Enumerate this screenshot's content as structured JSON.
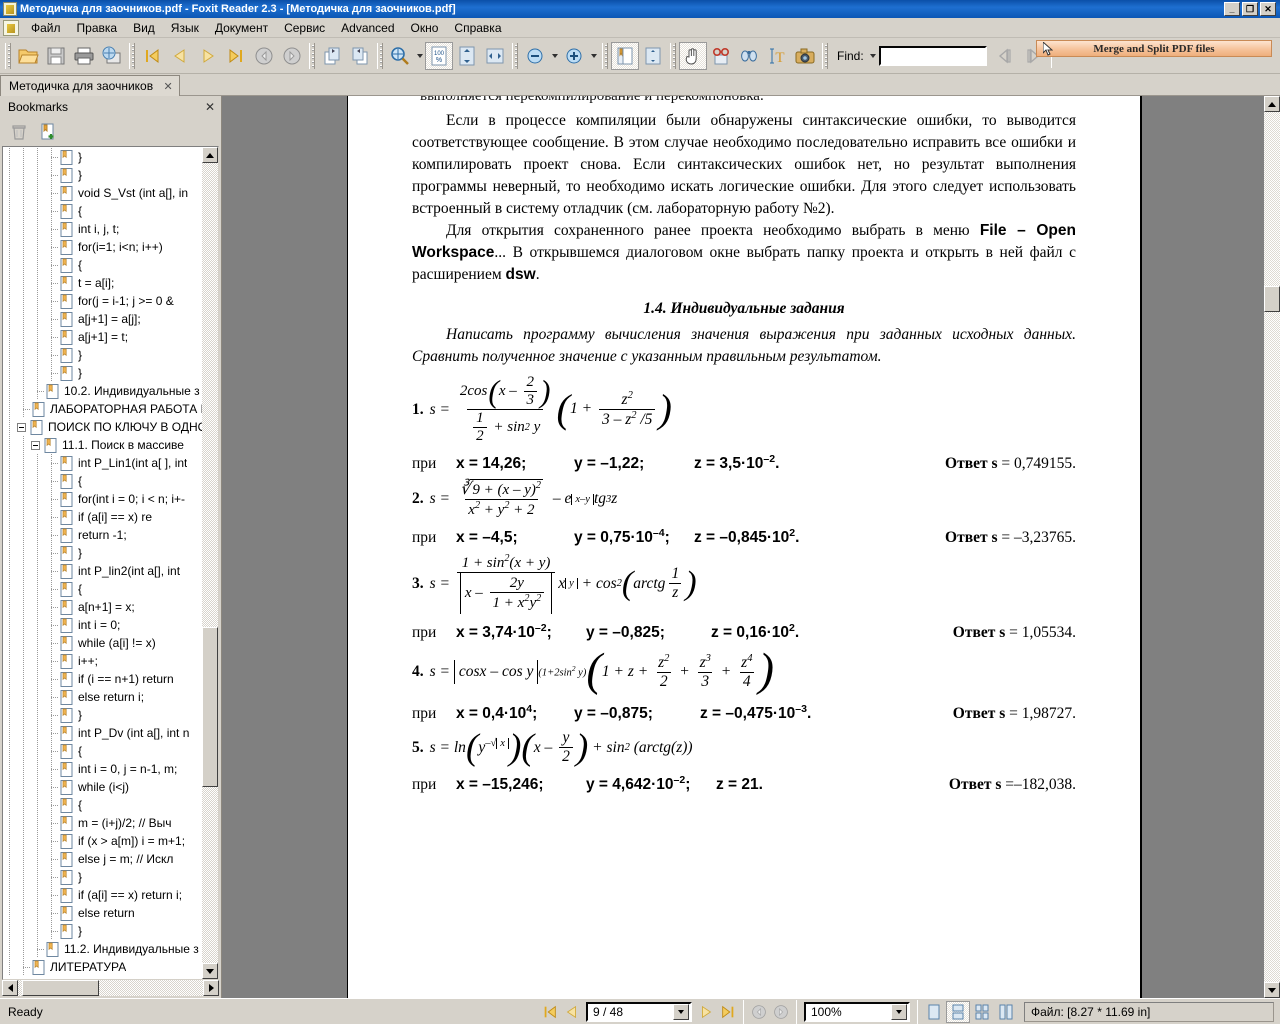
{
  "window": {
    "title": "Методичка для заочников.pdf - Foxit Reader 2.3 - [Методичка для заочников.pdf]",
    "minimize": "_",
    "maximize": "❐",
    "close": "✕"
  },
  "menu": {
    "items": [
      {
        "label": "Файл"
      },
      {
        "label": "Правка"
      },
      {
        "label": "Вид"
      },
      {
        "label": "Язык"
      },
      {
        "label": "Документ"
      },
      {
        "label": "Сервис"
      },
      {
        "label": "Advanced"
      },
      {
        "label": "Окно"
      },
      {
        "label": "Справка"
      }
    ]
  },
  "toolbar": {
    "find_label": "Find:",
    "find_value": "",
    "find_placeholder": "",
    "promo_label": "Merge and Split PDF files",
    "buttons": [
      {
        "name": "open-icon"
      },
      {
        "name": "save-icon"
      },
      {
        "name": "print-icon"
      },
      {
        "name": "email-icon"
      },
      {
        "name": "first-page-icon"
      },
      {
        "name": "previous-page-icon"
      },
      {
        "name": "next-page-icon"
      },
      {
        "name": "last-page-icon"
      },
      {
        "name": "go-back-icon"
      },
      {
        "name": "go-forward-icon"
      },
      {
        "name": "rotate-clockwise-icon"
      },
      {
        "name": "rotate-counterclockwise-icon"
      },
      {
        "name": "zoom-tool-icon"
      },
      {
        "name": "actual-size-icon"
      },
      {
        "name": "fit-page-icon"
      },
      {
        "name": "fit-width-icon"
      },
      {
        "name": "zoom-out-icon"
      },
      {
        "name": "zoom-in-icon"
      },
      {
        "name": "bookmarks-pane-icon"
      },
      {
        "name": "page-thumbnails-icon"
      },
      {
        "name": "hand-tool-icon"
      },
      {
        "name": "read-mode-icon"
      },
      {
        "name": "find-icon"
      },
      {
        "name": "text-select-icon"
      },
      {
        "name": "snapshot-icon"
      },
      {
        "name": "find-previous-icon"
      },
      {
        "name": "find-next-icon"
      }
    ]
  },
  "tab": {
    "label": "Методичка для заочников",
    "close": "✕"
  },
  "bookmarks": {
    "title": "Bookmarks",
    "close": "✕",
    "tools": [
      {
        "name": "delete-bookmark-icon"
      },
      {
        "name": "new-bookmark-icon"
      }
    ],
    "items": [
      {
        "label": "}",
        "indent": 4,
        "expander": "none"
      },
      {
        "label": "}",
        "indent": 4,
        "expander": "none"
      },
      {
        "label": "void S_Vst (int a[], in",
        "indent": 4,
        "expander": "none"
      },
      {
        "label": "{",
        "indent": 4,
        "expander": "none"
      },
      {
        "label": "  int i, j, t;",
        "indent": 4,
        "expander": "none"
      },
      {
        "label": "  for(i=1; i<n; i++)",
        "indent": 4,
        "expander": "none"
      },
      {
        "label": "    {",
        "indent": 4,
        "expander": "none"
      },
      {
        "label": "      t = a[i];",
        "indent": 4,
        "expander": "none"
      },
      {
        "label": "   for(j = i-1; j >= 0 &",
        "indent": 4,
        "expander": "none"
      },
      {
        "label": "          a[j+1] = a[j];",
        "indent": 4,
        "expander": "none"
      },
      {
        "label": "    a[j+1] = t;",
        "indent": 4,
        "expander": "none"
      },
      {
        "label": "      }",
        "indent": 4,
        "expander": "none"
      },
      {
        "label": "}",
        "indent": 4,
        "expander": "none"
      },
      {
        "label": "10.2. Индивидуальные з",
        "indent": 3,
        "expander": "none"
      },
      {
        "label": "ЛАБОРАТОРНАЯ РАБОТА N",
        "indent": 2,
        "expander": "none"
      },
      {
        "label": "ПОИСК ПО КЛЮЧУ В ОДНОМ",
        "indent": 2,
        "expander": "minus"
      },
      {
        "label": "11.1. Поиск в массиве",
        "indent": 3,
        "expander": "minus"
      },
      {
        "label": "int P_Lin1(int a[ ], int",
        "indent": 4,
        "expander": "none"
      },
      {
        "label": "{",
        "indent": 4,
        "expander": "none"
      },
      {
        "label": "for(int i = 0; i < n; i+-",
        "indent": 4,
        "expander": "none"
      },
      {
        "label": "       if (a[i] == x) re",
        "indent": 4,
        "expander": "none"
      },
      {
        "label": "   return -1;",
        "indent": 4,
        "expander": "none"
      },
      {
        "label": "}",
        "indent": 4,
        "expander": "none"
      },
      {
        "label": "int P_lin2(int a[], int",
        "indent": 4,
        "expander": "none"
      },
      {
        "label": "{",
        "indent": 4,
        "expander": "none"
      },
      {
        "label": "  a[n+1] = x;",
        "indent": 4,
        "expander": "none"
      },
      {
        "label": "  int i = 0;",
        "indent": 4,
        "expander": "none"
      },
      {
        "label": "  while (a[i] != x)",
        "indent": 4,
        "expander": "none"
      },
      {
        "label": "i++;",
        "indent": 4,
        "expander": "none"
      },
      {
        "label": "  if (i == n+1) return",
        "indent": 4,
        "expander": "none"
      },
      {
        "label": "             else return i;",
        "indent": 4,
        "expander": "none"
      },
      {
        "label": "}",
        "indent": 4,
        "expander": "none"
      },
      {
        "label": "int P_Dv (int a[], int n",
        "indent": 4,
        "expander": "none"
      },
      {
        "label": "{",
        "indent": 4,
        "expander": "none"
      },
      {
        "label": "  int i = 0, j = n-1, m;",
        "indent": 4,
        "expander": "none"
      },
      {
        "label": "while (i<j)",
        "indent": 4,
        "expander": "none"
      },
      {
        "label": "{",
        "indent": 4,
        "expander": "none"
      },
      {
        "label": "m = (i+j)/2;     // Выч",
        "indent": 4,
        "expander": "none"
      },
      {
        "label": "if (x > a[m]) i = m+1;",
        "indent": 4,
        "expander": "none"
      },
      {
        "label": " else j = m;    // Искл",
        "indent": 4,
        "expander": "none"
      },
      {
        "label": "}",
        "indent": 4,
        "expander": "none"
      },
      {
        "label": "if (a[i] == x) return i;",
        "indent": 4,
        "expander": "none"
      },
      {
        "label": "             else return",
        "indent": 4,
        "expander": "none"
      },
      {
        "label": "}",
        "indent": 4,
        "expander": "none"
      },
      {
        "label": "11.2. Индивидуальные з",
        "indent": 3,
        "expander": "none"
      },
      {
        "label": "ЛИТЕРАТУРА",
        "indent": 2,
        "expander": "none"
      }
    ]
  },
  "document": {
    "clipped_top_line": "выполняется перекомпилирование и перекомпоновка.",
    "paragraphs": [
      "Если в процессе компиляции были обнаружены синтаксические ошибки, то выводится соответствующее сообщение. В этом случае необходимо последовательно исправить все ошибки и компилировать проект снова. Если синтаксических ошибок нет, но результат выполнения программы неверный, то необходимо искать логические ошибки. Для этого следует использовать встроенный в систему отладчик (см. лабораторную работу №2)."
    ],
    "paragraph2": {
      "before": "Для открытия сохраненного ранее проекта необходимо выбрать в меню ",
      "bold1": "File – Open Workspace",
      "middle": "... В открывшемся диалоговом окне выбрать папку проекта и открыть в ней файл с расширением ",
      "bold2": "dsw",
      "after": "."
    },
    "section_title": "1.4. Индивидуальные задания",
    "intro": "Написать программу вычисления значения выражения при заданных исходных данных. Сравнить полученное значение с указанным правильным результатом.",
    "tasks": [
      {
        "num": "1.",
        "given_label": "при",
        "x": "x = 14,26;",
        "y": "y = –1,22;",
        "z": "z = 3,5·10",
        "z_exp": "–2",
        "z_tail": ".",
        "answer_label": "Ответ s",
        "answer_value": "= 0,749155."
      },
      {
        "num": "2.",
        "given_label": "при",
        "x": "x = –4,5;",
        "y": "y = 0,75·10",
        "y_exp": "–4",
        "y_tail": ";",
        "z": "z = –0,845·10",
        "z_exp": "2",
        "z_tail": ".",
        "answer_label": "Ответ s",
        "answer_value": "= –3,23765."
      },
      {
        "num": "3.",
        "given_label": "при",
        "x": "x = 3,74·10",
        "x_exp": "–2",
        "x_tail": ";",
        "y": "y = –0,825;",
        "z": "z = 0,16·10",
        "z_exp": "2",
        "z_tail": ".",
        "answer_label": "Ответ s",
        "answer_value": "= 1,05534."
      },
      {
        "num": "4.",
        "given_label": "при",
        "x": "x = 0,4·10",
        "x_exp": "4",
        "x_tail": ";",
        "y": "y = –0,875;",
        "z": "z = –0,475·10",
        "z_exp": "–3",
        "z_tail": ".",
        "answer_label": "Ответ s",
        "answer_value": "= 1,98727."
      },
      {
        "num": "5.",
        "given_label": "при",
        "x": "x = –15,246;",
        "y": "y = 4,642·10",
        "y_exp": "–2",
        "y_tail": ";",
        "z": "z = 21.",
        "answer_label": "Ответ s",
        "answer_value": "=–182,038."
      }
    ]
  },
  "statusbar": {
    "ready": "Ready",
    "page_value": "9 / 48",
    "zoom_value": "100%",
    "file_info": "Файл: [8.27 * 11.69 in]",
    "nav": [
      {
        "name": "first-page-icon"
      },
      {
        "name": "previous-page-icon"
      },
      {
        "name": "next-page-icon"
      },
      {
        "name": "last-page-icon"
      },
      {
        "name": "go-back-icon"
      },
      {
        "name": "go-forward-icon"
      }
    ],
    "layouts": [
      {
        "name": "single-page-layout-icon"
      },
      {
        "name": "continuous-layout-icon"
      },
      {
        "name": "facing-layout-icon"
      },
      {
        "name": "continuous-facing-layout-icon"
      }
    ]
  },
  "colors": {
    "titlebar": "#1e6fd0",
    "chrome": "#d6d2ca",
    "viewer_bg": "#808080",
    "promo": "#f6c39b"
  }
}
